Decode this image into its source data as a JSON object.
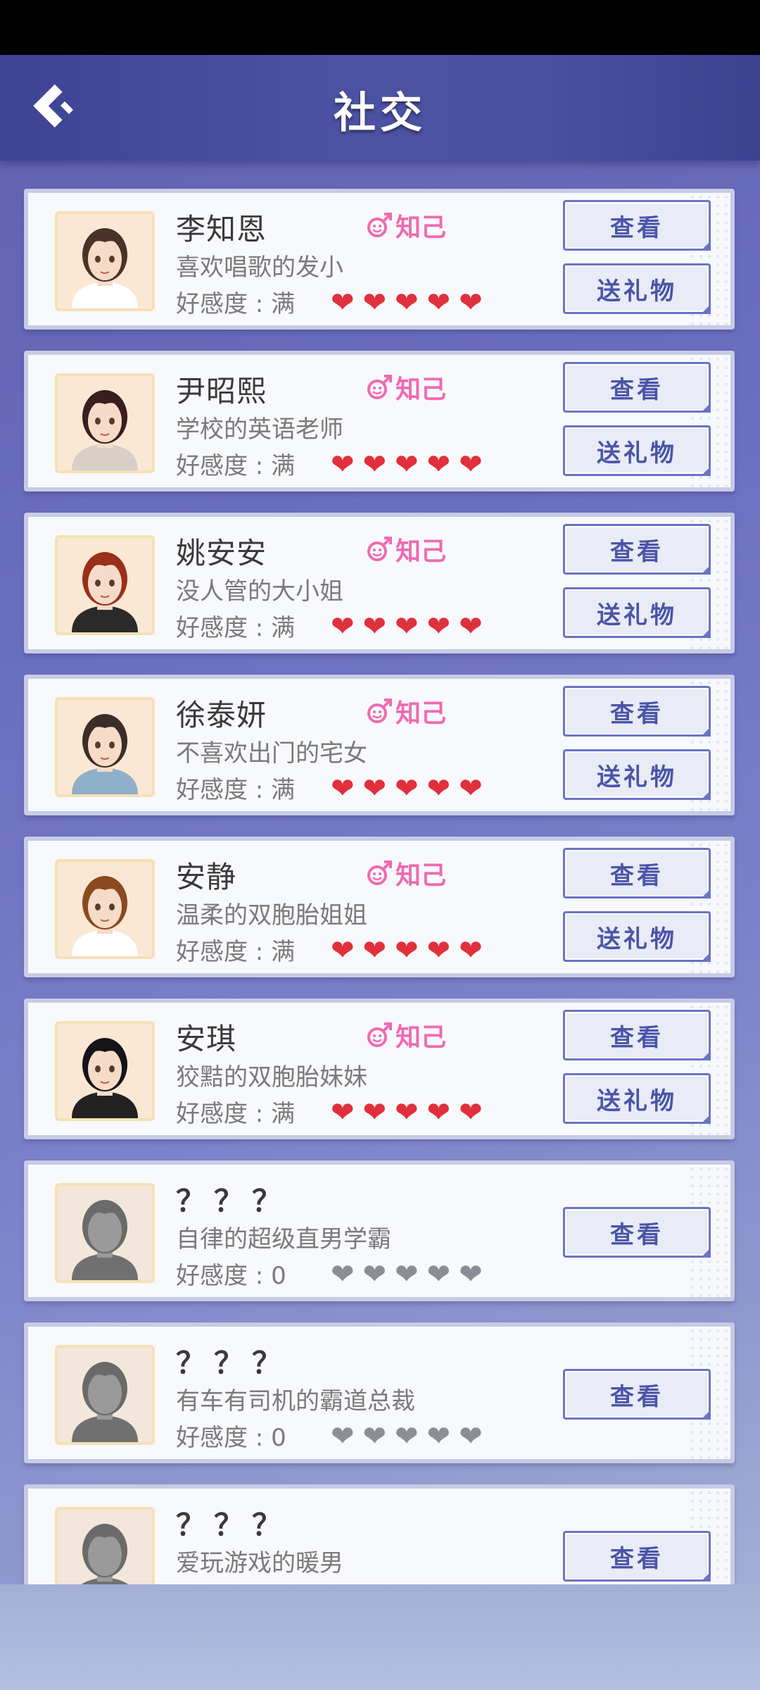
{
  "header": {
    "title": "社交"
  },
  "labels": {
    "view": "查看",
    "gift": "送礼物",
    "badge": "知己"
  },
  "colors": {
    "heart_full": "#e0303c",
    "heart_empty": "#8a8e97",
    "badge": "#f06ab0",
    "button_text": "#4a55a8"
  },
  "characters": [
    {
      "name": "李知恩",
      "desc": "喜欢唱歌的发小",
      "favor": "好感度 : 满",
      "hearts_filled": 5,
      "hearts_total": 5,
      "is_confidant": true,
      "unlocked": true,
      "hair": "#4a3326"
    },
    {
      "name": "尹昭熙",
      "desc": "学校的英语老师",
      "favor": "好感度 : 满",
      "hearts_filled": 5,
      "hearts_total": 5,
      "is_confidant": true,
      "unlocked": true,
      "hair": "#3a1e1e"
    },
    {
      "name": "姚安安",
      "desc": "没人管的大小姐",
      "favor": "好感度 : 满",
      "hearts_filled": 5,
      "hearts_total": 5,
      "is_confidant": true,
      "unlocked": true,
      "hair": "#9a2f1a"
    },
    {
      "name": "徐泰妍",
      "desc": "不喜欢出门的宅女",
      "favor": "好感度 : 满",
      "hearts_filled": 5,
      "hearts_total": 5,
      "is_confidant": true,
      "unlocked": true,
      "hair": "#3b2d27"
    },
    {
      "name": "安静",
      "desc": "温柔的双胞胎姐姐",
      "favor": "好感度 : 满",
      "hearts_filled": 5,
      "hearts_total": 5,
      "is_confidant": true,
      "unlocked": true,
      "hair": "#8a4a20"
    },
    {
      "name": "安琪",
      "desc": "狡黠的双胞胎妹妹",
      "favor": "好感度 : 满",
      "hearts_filled": 5,
      "hearts_total": 5,
      "is_confidant": true,
      "unlocked": true,
      "hair": "#151418"
    },
    {
      "name": "？？？",
      "desc": "自律的超级直男学霸",
      "favor": "好感度 : 0",
      "hearts_filled": 0,
      "hearts_total": 5,
      "is_confidant": false,
      "unlocked": false,
      "hair": "#555555"
    },
    {
      "name": "？？？",
      "desc": "有车有司机的霸道总裁",
      "favor": "好感度 : 0",
      "hearts_filled": 0,
      "hearts_total": 5,
      "is_confidant": false,
      "unlocked": false,
      "hair": "#555555"
    },
    {
      "name": "？？？",
      "desc": "爱玩游戏的暖男",
      "favor": "",
      "hearts_filled": 0,
      "hearts_total": 5,
      "is_confidant": false,
      "unlocked": false,
      "hair": "#555555"
    }
  ]
}
